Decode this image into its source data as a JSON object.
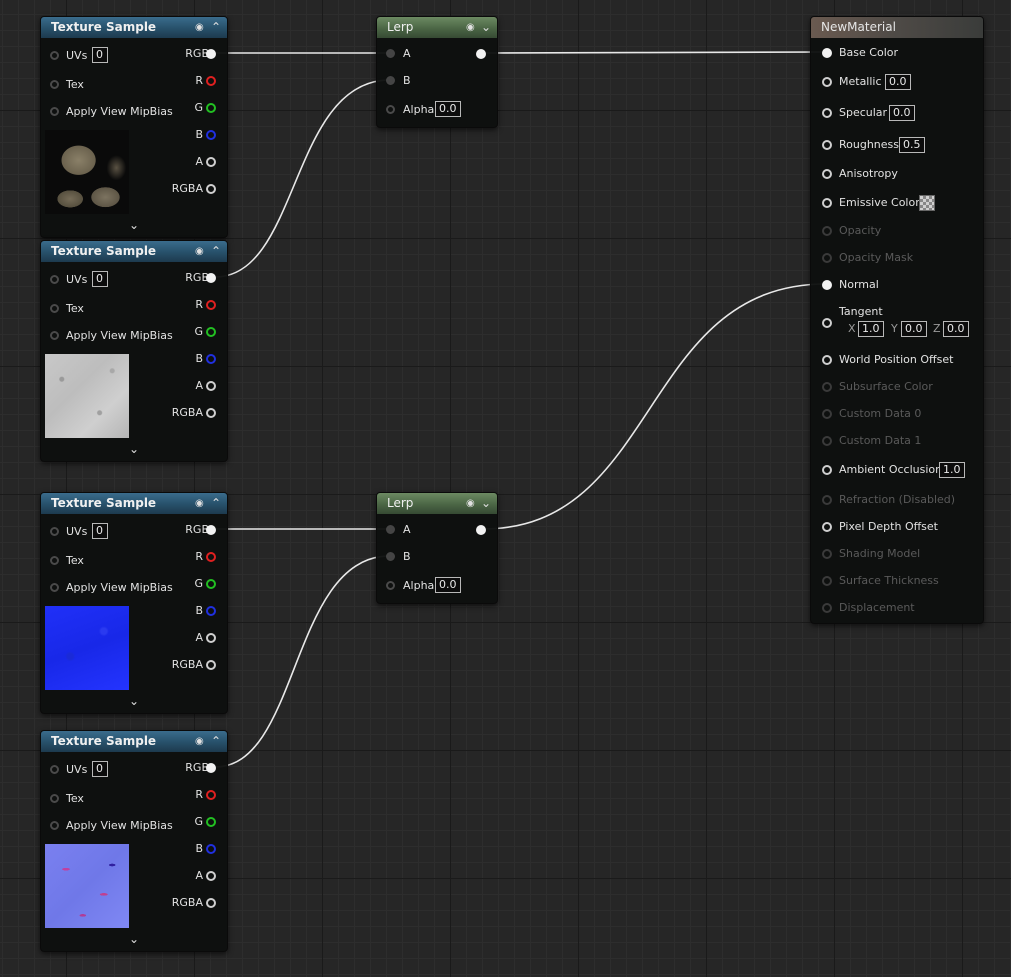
{
  "texture_nodes": [
    {
      "title": "Texture Sample",
      "uvs_label": "UVs",
      "uvs_value": "0",
      "tex_label": "Tex",
      "mip_label": "Apply View MipBias",
      "outputs": [
        "RGB",
        "R",
        "G",
        "B",
        "A",
        "RGBA"
      ],
      "preview": "rock-diffuse"
    },
    {
      "title": "Texture Sample",
      "uvs_label": "UVs",
      "uvs_value": "0",
      "tex_label": "Tex",
      "mip_label": "Apply View MipBias",
      "outputs": [
        "RGB",
        "R",
        "G",
        "B",
        "A",
        "RGBA"
      ],
      "preview": "plaster-diffuse"
    },
    {
      "title": "Texture Sample",
      "uvs_label": "UVs",
      "uvs_value": "0",
      "tex_label": "Tex",
      "mip_label": "Apply View MipBias",
      "outputs": [
        "RGB",
        "R",
        "G",
        "B",
        "A",
        "RGBA"
      ],
      "preview": "flat-normal"
    },
    {
      "title": "Texture Sample",
      "uvs_label": "UVs",
      "uvs_value": "0",
      "tex_label": "Tex",
      "mip_label": "Apply View MipBias",
      "outputs": [
        "RGB",
        "R",
        "G",
        "B",
        "A",
        "RGBA"
      ],
      "preview": "detail-normal"
    }
  ],
  "lerp_nodes": [
    {
      "title": "Lerp",
      "a_label": "A",
      "b_label": "B",
      "alpha_label": "Alpha",
      "alpha_value": "0.0"
    },
    {
      "title": "Lerp",
      "a_label": "A",
      "b_label": "B",
      "alpha_label": "Alpha",
      "alpha_value": "0.0"
    }
  ],
  "material_node": {
    "title": "NewMaterial",
    "base_color": "Base Color",
    "metallic": {
      "label": "Metallic",
      "value": "0.0"
    },
    "specular": {
      "label": "Specular",
      "value": "0.0"
    },
    "roughness": {
      "label": "Roughness",
      "value": "0.5"
    },
    "anisotropy": "Anisotropy",
    "emissive": "Emissive Color",
    "opacity": "Opacity",
    "opacity_mask": "Opacity Mask",
    "normal": "Normal",
    "tangent": {
      "label": "Tangent",
      "x_label": "X",
      "x": "1.0",
      "y_label": "Y",
      "y": "0.0",
      "z_label": "Z",
      "z": "0.0"
    },
    "wpo": "World Position Offset",
    "subsurface": "Subsurface Color",
    "custom0": "Custom Data 0",
    "custom1": "Custom Data 1",
    "ao": {
      "label": "Ambient Occlusion",
      "value": "1.0"
    },
    "refraction": "Refraction (Disabled)",
    "pdo": "Pixel Depth Offset",
    "shading_model": "Shading Model",
    "surface_thickness": "Surface Thickness",
    "displacement": "Displacement"
  },
  "pin_colors": {
    "r": "#e02020",
    "g": "#22c022",
    "b": "#2030e0",
    "exec": "#f2f2f2"
  }
}
